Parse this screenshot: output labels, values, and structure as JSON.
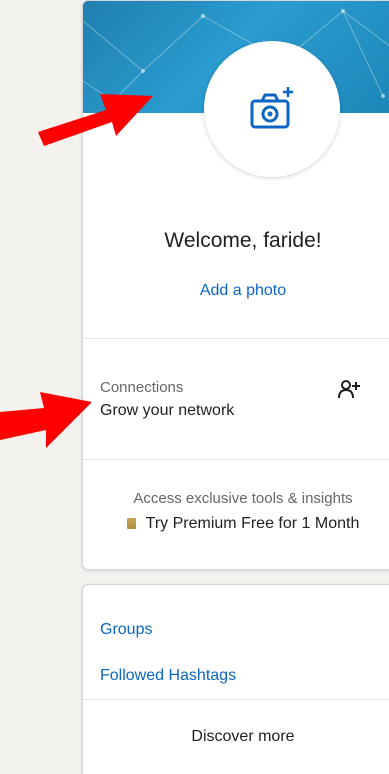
{
  "profile": {
    "welcome": "Welcome, faride!",
    "add_photo": "Add a photo",
    "avatar_icon": "camera-add-icon"
  },
  "connections": {
    "label": "Connections",
    "subtitle": "Grow your network",
    "icon": "add-connection-icon"
  },
  "premium": {
    "caption": "Access exclusive tools & insights",
    "cta": "Try Premium Free for 1 Month",
    "icon": "premium-badge-icon"
  },
  "links": {
    "items": [
      {
        "label": "Groups"
      },
      {
        "label": "Followed Hashtags"
      }
    ],
    "discover": "Discover more"
  },
  "colors": {
    "link": "#0a66c2",
    "banner": "#1f7fb0",
    "annotation": "#ff0000"
  }
}
